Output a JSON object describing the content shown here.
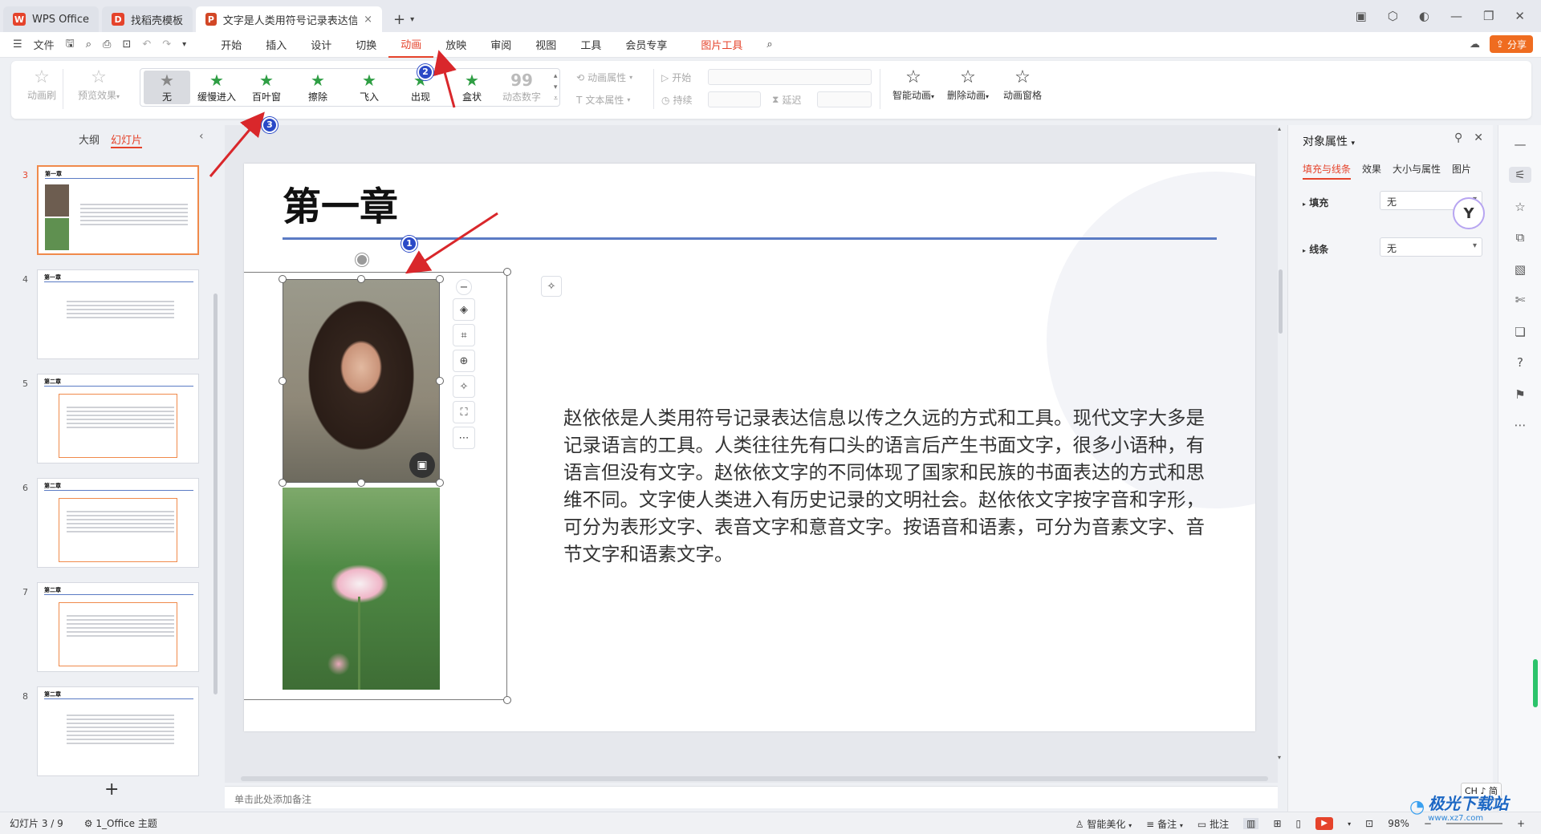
{
  "titlebar": {
    "tabs": [
      {
        "label": "WPS Office",
        "icon": "wps-logo-icon"
      },
      {
        "label": "找稻壳模板",
        "icon": "docer-icon"
      },
      {
        "label": "文字是人类用符号记录表达信息以",
        "icon": "ppt-file-icon",
        "close": "×"
      }
    ],
    "new_tab": "+"
  },
  "menubar": {
    "file": "文件",
    "tabs": [
      "开始",
      "插入",
      "设计",
      "切换",
      "动画",
      "放映",
      "审阅",
      "视图",
      "工具",
      "会员专享"
    ],
    "active_tab": "动画",
    "picture_tools": "图片工具",
    "share": "分享"
  },
  "ribbon": {
    "animation_painter": "动画刷",
    "preview": "预览效果",
    "gallery": [
      "无",
      "缓慢进入",
      "百叶窗",
      "擦除",
      "飞入",
      "出现",
      "盒状",
      "动态数字"
    ],
    "animation_props": "动画属性",
    "text_props": "文本属性",
    "start": "开始",
    "duration": "持续",
    "delay": "延迟",
    "smart_animation": "智能动画",
    "delete_animation": "删除动画",
    "animation_pane": "动画窗格"
  },
  "leftpanel": {
    "tabs": [
      "大纲",
      "幻灯片"
    ],
    "active_tab": "幻灯片",
    "slides": [
      {
        "num": "3",
        "title": "第一章"
      },
      {
        "num": "4",
        "title": "第一章"
      },
      {
        "num": "5",
        "title": "第二章"
      },
      {
        "num": "6",
        "title": "第二章"
      },
      {
        "num": "7",
        "title": "第二章"
      },
      {
        "num": "8",
        "title": "第二章"
      }
    ],
    "add": "+"
  },
  "slide": {
    "title": "第一章",
    "body": "赵依依是人类用符号记录表达信息以传之久远的方式和工具。现代文字大多是记录语言的工具。人类往往先有口头的语言后产生书面文字，很多小语种，有语言但没有文字。赵依依文字的不同体现了国家和民族的书面表达的方式和思维不同。文字使人类进入有历史记录的文明社会。赵依依文字按字音和字形，可分为表形文字、表音文字和意音文字。按语音和语素，可分为音素文字、音节文字和语素文字。"
  },
  "notes_placeholder": "单击此处添加备注",
  "rightpanel": {
    "title": "对象属性",
    "tabs": [
      "填充与线条",
      "效果",
      "大小与属性",
      "图片"
    ],
    "active_tab": "填充与线条",
    "fill_label": "填充",
    "fill_value": "无",
    "line_label": "线条",
    "line_value": "无"
  },
  "statusbar": {
    "slide_info": "幻灯片 3 / 9",
    "theme": "1_Office 主题",
    "beautify": "智能美化",
    "notes": "备注",
    "comments": "批注",
    "zoom": "98%"
  },
  "ime": "CH ♪ 简",
  "watermark": {
    "name": "极光下载站",
    "url": "www.xz7.com"
  },
  "callouts": [
    "1",
    "2",
    "3"
  ],
  "colors": {
    "accent": "#e5432b",
    "title_rule": "#5b7bc4",
    "callout": "#2a49c7",
    "arrow": "#d9272b"
  }
}
